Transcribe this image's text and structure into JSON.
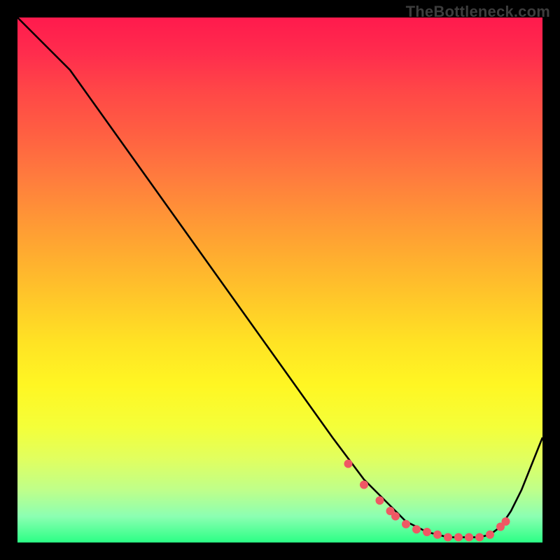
{
  "attribution": "TheBottleneck.com",
  "colors": {
    "curve_stroke": "#000000",
    "marker_fill": "#ef5864",
    "gradient_top": "#ff1a4d",
    "gradient_bottom": "#2bff85",
    "frame_bg": "#000000"
  },
  "chart_data": {
    "type": "line",
    "title": "",
    "xlabel": "",
    "ylabel": "",
    "xlim": [
      0,
      100
    ],
    "ylim": [
      0,
      100
    ],
    "x": [
      0,
      6,
      10,
      15,
      20,
      25,
      30,
      35,
      40,
      45,
      50,
      55,
      60,
      63,
      66,
      69,
      72,
      74,
      76,
      78,
      80,
      82,
      84,
      86,
      88,
      90,
      92,
      94,
      96,
      98,
      100
    ],
    "values": [
      100,
      94,
      90,
      83,
      76,
      69,
      62,
      55,
      48,
      41,
      34,
      27,
      20,
      16,
      12,
      9,
      6,
      4,
      3,
      2,
      1.5,
      1,
      1,
      1,
      1,
      1.5,
      3,
      6,
      10,
      15,
      20
    ],
    "markers": {
      "x": [
        63,
        66,
        69,
        71,
        72,
        74,
        76,
        78,
        80,
        82,
        84,
        86,
        88,
        90,
        92,
        93
      ],
      "values": [
        15,
        11,
        8,
        6,
        5,
        3.5,
        2.5,
        2,
        1.5,
        1,
        1,
        1,
        1,
        1.5,
        3,
        4
      ]
    }
  }
}
